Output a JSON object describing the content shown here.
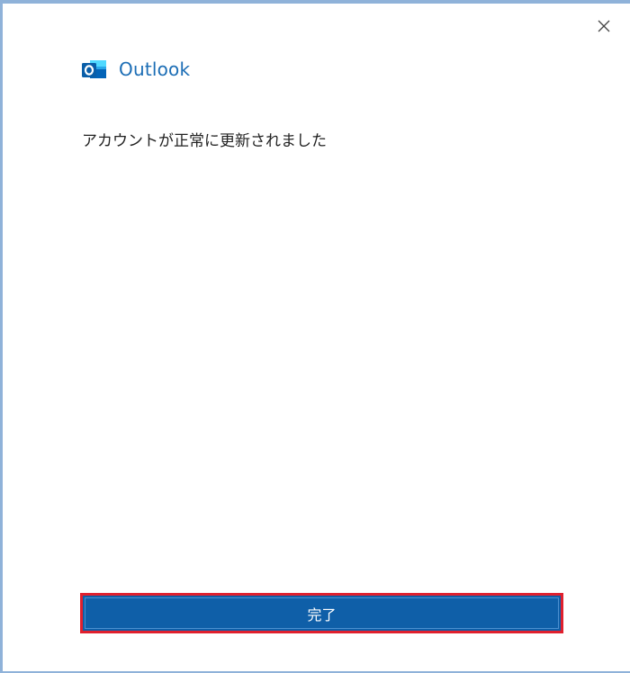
{
  "window": {
    "close_icon": "close-icon"
  },
  "header": {
    "logo_icon": "outlook-logo-icon",
    "app_title": "Outlook"
  },
  "main": {
    "message": "アカウントが正常に更新されました"
  },
  "footer": {
    "done_label": "完了"
  },
  "colors": {
    "accent": "#0f5fa8",
    "title": "#1b6db5",
    "highlight_border": "#e0202e",
    "window_border": "#8fb2d9"
  }
}
